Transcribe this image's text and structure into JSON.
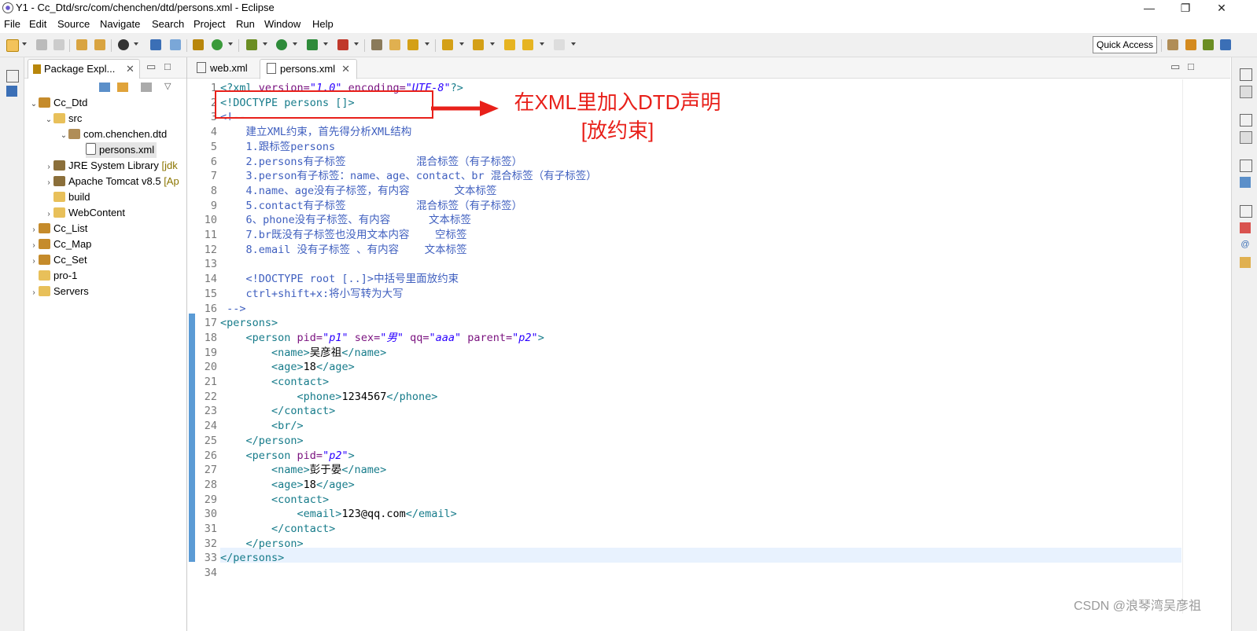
{
  "window": {
    "title": "Y1 - Cc_Dtd/src/com/chenchen/dtd/persons.xml - Eclipse",
    "minimize": "—",
    "restore": "❐",
    "close": "✕"
  },
  "menu": [
    "File",
    "Edit",
    "Source",
    "Navigate",
    "Search",
    "Project",
    "Run",
    "Window",
    "Help"
  ],
  "toolbar": {
    "quick_access": "Quick Access"
  },
  "package_explorer": {
    "tab_label": "Package Expl...",
    "tree": [
      {
        "label": "Cc_Dtd",
        "extra": ""
      },
      {
        "label": "src",
        "extra": ""
      },
      {
        "label": "com.chenchen.dtd",
        "extra": ""
      },
      {
        "label": "persons.xml",
        "extra": ""
      },
      {
        "label": "JRE System Library",
        "extra": "[jdk"
      },
      {
        "label": "Apache Tomcat v8.5",
        "extra": "[Ap"
      },
      {
        "label": "build",
        "extra": ""
      },
      {
        "label": "WebContent",
        "extra": ""
      },
      {
        "label": "Cc_List",
        "extra": ""
      },
      {
        "label": "Cc_Map",
        "extra": ""
      },
      {
        "label": "Cc_Set",
        "extra": ""
      },
      {
        "label": "pro-1",
        "extra": ""
      },
      {
        "label": "Servers",
        "extra": ""
      }
    ]
  },
  "editor": {
    "tabs": [
      "web.xml",
      "persons.xml"
    ],
    "line_numbers": [
      "1",
      "2",
      "3",
      "4",
      "5",
      "6",
      "7",
      "8",
      "9",
      "10",
      "11",
      "12",
      "13",
      "14",
      "15",
      "16",
      "17",
      "18",
      "19",
      "20",
      "21",
      "22",
      "23",
      "24",
      "25",
      "26",
      "27",
      "28",
      "29",
      "30",
      "31",
      "32",
      "33",
      "34"
    ],
    "lines": [
      {
        "num": "1",
        "segs": [
          [
            "tag",
            "<?xml "
          ],
          [
            "attr",
            "version="
          ],
          [
            "val",
            "\"1.0\""
          ],
          [
            "attr",
            " encoding="
          ],
          [
            "val",
            "\"UTF-8\""
          ],
          [
            "tag",
            "?>"
          ]
        ]
      },
      {
        "num": "2",
        "segs": [
          [
            "tag",
            "<!DOCTYPE persons []>"
          ]
        ]
      },
      {
        "num": "3",
        "segs": [
          [
            "cm",
            "<!--"
          ]
        ]
      },
      {
        "num": "4",
        "segs": [
          [
            "cm",
            "    建立XML约束，首先得分析XML结构"
          ]
        ]
      },
      {
        "num": "5",
        "segs": [
          [
            "cm",
            "    1.跟标签persons"
          ]
        ]
      },
      {
        "num": "6",
        "segs": [
          [
            "cm",
            "    2.persons有子标签           混合标签（有子标签）"
          ]
        ]
      },
      {
        "num": "7",
        "segs": [
          [
            "cm",
            "    3.person有子标签：name、age、contact、br 混合标签（有子标签）"
          ]
        ]
      },
      {
        "num": "8",
        "segs": [
          [
            "cm",
            "    4.name、age没有子标签，有内容       文本标签"
          ]
        ]
      },
      {
        "num": "9",
        "segs": [
          [
            "cm",
            "    5.contact有子标签           混合标签（有子标签）"
          ]
        ]
      },
      {
        "num": "10",
        "segs": [
          [
            "cm",
            "    6、phone没有子标签、有内容      文本标签"
          ]
        ]
      },
      {
        "num": "11",
        "segs": [
          [
            "cm",
            "    7.br既没有子标签也没用文本内容    空标签"
          ]
        ]
      },
      {
        "num": "12",
        "segs": [
          [
            "cm",
            "    8.email 没有子标签 、有内容    文本标签"
          ]
        ]
      },
      {
        "num": "13",
        "segs": [
          [
            "cm",
            ""
          ]
        ]
      },
      {
        "num": "14",
        "segs": [
          [
            "cm",
            "    <!DOCTYPE root [..]>中括号里面放约束"
          ]
        ]
      },
      {
        "num": "15",
        "segs": [
          [
            "cm",
            "    ctrl+shift+x:将小写转为大写"
          ]
        ]
      },
      {
        "num": "16",
        "segs": [
          [
            "cm",
            " -->"
          ]
        ]
      },
      {
        "num": "17",
        "segs": [
          [
            "tag",
            "<persons>"
          ]
        ]
      },
      {
        "num": "18",
        "segs": [
          [
            "tag",
            "    <person "
          ],
          [
            "attr",
            "pid="
          ],
          [
            "val",
            "\"p1\""
          ],
          [
            "attr",
            " sex="
          ],
          [
            "val",
            "\"男\""
          ],
          [
            "attr",
            " qq="
          ],
          [
            "val",
            "\"aaa\""
          ],
          [
            "attr",
            " parent="
          ],
          [
            "val",
            "\"p2\""
          ],
          [
            "tag",
            ">"
          ]
        ]
      },
      {
        "num": "19",
        "segs": [
          [
            "tag",
            "        <name>"
          ],
          [
            "txt",
            "吴彦祖"
          ],
          [
            "tag",
            "</name>"
          ]
        ]
      },
      {
        "num": "20",
        "segs": [
          [
            "tag",
            "        <age>"
          ],
          [
            "txt",
            "18"
          ],
          [
            "tag",
            "</age>"
          ]
        ]
      },
      {
        "num": "21",
        "segs": [
          [
            "tag",
            "        <contact>"
          ]
        ]
      },
      {
        "num": "22",
        "segs": [
          [
            "tag",
            "            <phone>"
          ],
          [
            "txt",
            "1234567"
          ],
          [
            "tag",
            "</phone>"
          ]
        ]
      },
      {
        "num": "23",
        "segs": [
          [
            "tag",
            "        </contact>"
          ]
        ]
      },
      {
        "num": "24",
        "segs": [
          [
            "tag",
            "        <br/>"
          ]
        ]
      },
      {
        "num": "25",
        "segs": [
          [
            "tag",
            "    </person>"
          ]
        ]
      },
      {
        "num": "26",
        "segs": [
          [
            "tag",
            "    <person "
          ],
          [
            "attr",
            "pid="
          ],
          [
            "val",
            "\"p2\""
          ],
          [
            "tag",
            ">"
          ]
        ]
      },
      {
        "num": "27",
        "segs": [
          [
            "tag",
            "        <name>"
          ],
          [
            "txt",
            "彭于晏"
          ],
          [
            "tag",
            "</name>"
          ]
        ]
      },
      {
        "num": "28",
        "segs": [
          [
            "tag",
            "        <age>"
          ],
          [
            "txt",
            "18"
          ],
          [
            "tag",
            "</age>"
          ]
        ]
      },
      {
        "num": "29",
        "segs": [
          [
            "tag",
            "        <contact>"
          ]
        ]
      },
      {
        "num": "30",
        "segs": [
          [
            "tag",
            "            <email>"
          ],
          [
            "txt",
            "123@qq.com"
          ],
          [
            "tag",
            "</email>"
          ]
        ]
      },
      {
        "num": "31",
        "segs": [
          [
            "tag",
            "        </contact>"
          ]
        ]
      },
      {
        "num": "32",
        "segs": [
          [
            "tag",
            "    </person>"
          ]
        ]
      },
      {
        "num": "33",
        "segs": [
          [
            "tag",
            "</persons>"
          ]
        ]
      },
      {
        "num": "34",
        "segs": [
          [
            "txt",
            ""
          ]
        ]
      }
    ]
  },
  "annotation": {
    "line1": "在XML里加入DTD声明",
    "line2": "[放约束]"
  },
  "watermark": "CSDN @浪琴湾吴彦祖",
  "colors": {
    "annotation": "#e8201a",
    "tag": "#167b8a",
    "attr": "#7a127f",
    "value": "#2a00ff",
    "comment": "#3f5fbf"
  }
}
